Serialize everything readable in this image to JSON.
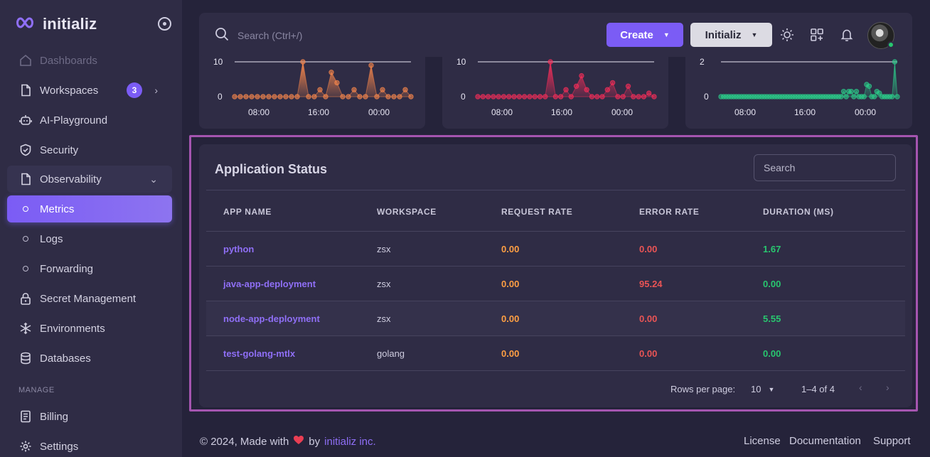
{
  "brand": {
    "name": "initializ"
  },
  "sidebar": {
    "items": [
      {
        "label": "Dashboards"
      },
      {
        "label": "Workspaces",
        "badge": "3"
      },
      {
        "label": "AI-Playground"
      },
      {
        "label": "Security"
      },
      {
        "label": "Observability"
      },
      {
        "label": "Metrics"
      },
      {
        "label": "Logs"
      },
      {
        "label": "Forwarding"
      },
      {
        "label": "Secret Management"
      },
      {
        "label": "Environments"
      },
      {
        "label": "Databases"
      }
    ],
    "section_manage": "MANAGE",
    "manage_items": [
      {
        "label": "Billing"
      },
      {
        "label": "Settings"
      }
    ]
  },
  "topbar": {
    "search_placeholder": "Search (Ctrl+/)",
    "create_label": "Create",
    "org_label": "Initializ"
  },
  "mini_charts": [
    {
      "ymax": "10",
      "ymin": "0",
      "ticks": [
        "08:00",
        "16:00",
        "00:00"
      ],
      "color": "#ff8a4c"
    },
    {
      "ymax": "10",
      "ymin": "0",
      "ticks": [
        "08:00",
        "16:00",
        "00:00"
      ],
      "color": "#ff2d5a"
    },
    {
      "ymax": "2",
      "ymin": "0",
      "ticks": [
        "08:00",
        "16:00",
        "00:00"
      ],
      "color": "#2bd08b"
    }
  ],
  "chart_data": [
    {
      "type": "area",
      "x_ticks": [
        "08:00",
        "16:00",
        "00:00"
      ],
      "ylim": [
        0,
        10
      ],
      "values": [
        0,
        0,
        0,
        0,
        0,
        0,
        0,
        0,
        0,
        0,
        0,
        0,
        10,
        0,
        0,
        2,
        0,
        7,
        4,
        0,
        0,
        2,
        0,
        0,
        9,
        0,
        2,
        0,
        0,
        0,
        2,
        0
      ]
    },
    {
      "type": "area",
      "x_ticks": [
        "08:00",
        "16:00",
        "00:00"
      ],
      "ylim": [
        0,
        10
      ],
      "values": [
        0,
        0,
        0,
        0,
        0,
        0,
        0,
        0,
        0,
        0,
        0,
        0,
        0,
        0,
        10,
        0,
        0,
        2,
        0,
        3,
        6,
        2,
        0,
        0,
        0,
        2,
        4,
        0,
        0,
        3,
        0,
        0,
        0,
        1,
        0
      ]
    },
    {
      "type": "area",
      "x_ticks": [
        "08:00",
        "16:00",
        "00:00"
      ],
      "ylim": [
        0,
        2
      ],
      "values": [
        0,
        0,
        0,
        0,
        0,
        0,
        0,
        0,
        0,
        0,
        0,
        0,
        0,
        0,
        0,
        0,
        0,
        0,
        0,
        0,
        0,
        0,
        0,
        0,
        0,
        0,
        0,
        0,
        0,
        0,
        0,
        0,
        0,
        0,
        0,
        0,
        0,
        0,
        0,
        0,
        0,
        0,
        0,
        0,
        0,
        0,
        0,
        0,
        0.3,
        0,
        0.3,
        0.3,
        0,
        0.3,
        0,
        0,
        0,
        0.7,
        0.6,
        0,
        0,
        0.3,
        0.2,
        0,
        0,
        0,
        0,
        0,
        2,
        0
      ]
    }
  ],
  "status": {
    "title": "Application Status",
    "search_placeholder": "Search",
    "columns": [
      "APP NAME",
      "WORKSPACE",
      "REQUEST RATE",
      "ERROR RATE",
      "DURATION (MS)"
    ],
    "rows": [
      {
        "app": "python",
        "workspace": "zsx",
        "request": "0.00",
        "error": "0.00",
        "duration": "1.67"
      },
      {
        "app": "java-app-deployment",
        "workspace": "zsx",
        "request": "0.00",
        "error": "95.24",
        "duration": "0.00"
      },
      {
        "app": "node-app-deployment",
        "workspace": "zsx",
        "request": "0.00",
        "error": "0.00",
        "duration": "5.55"
      },
      {
        "app": "test-golang-mtlx",
        "workspace": "golang",
        "request": "0.00",
        "error": "0.00",
        "duration": "0.00"
      }
    ],
    "rows_per_page_label": "Rows per page:",
    "rows_per_page_value": "10",
    "range": "1–4 of 4"
  },
  "footer": {
    "copyright": "© 2024, Made with",
    "by": "by",
    "company": "initializ inc.",
    "links": [
      "License",
      "Documentation",
      "Support"
    ]
  },
  "colors": {
    "accent": "#7b5cf5",
    "request": "#ff9f43",
    "error": "#ea5455",
    "duration": "#28c76f"
  }
}
